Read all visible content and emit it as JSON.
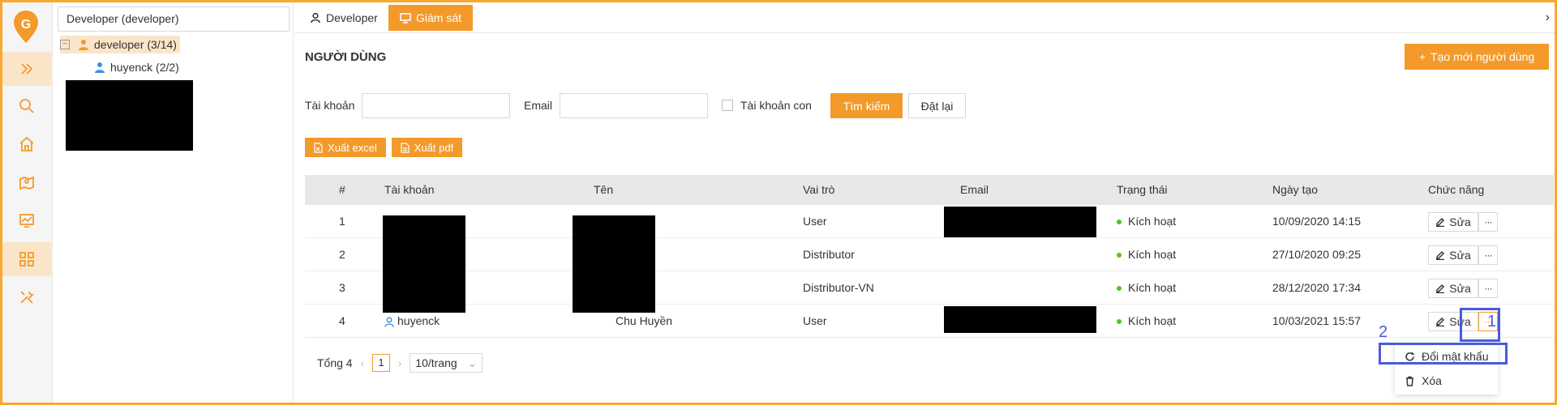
{
  "tree": {
    "search_value": "Developer (developer)",
    "root_node": "developer (3/14)",
    "child_node": "huyenck (2/2)"
  },
  "tabs": [
    {
      "label": "Developer"
    },
    {
      "label": "Giám sát"
    }
  ],
  "page_title": "NGƯỜI DÙNG",
  "create_button": "Tạo mới người dùng",
  "filters": {
    "account_label": "Tài khoản",
    "account_value": "",
    "email_label": "Email",
    "email_value": "",
    "sub_account_label": "Tài khoản con",
    "search_button": "Tìm kiếm",
    "reset_button": "Đặt lại"
  },
  "export": {
    "excel": "Xuất excel",
    "pdf": "Xuất pdf"
  },
  "table": {
    "headers": [
      "#",
      "Tài khoản",
      "Tên",
      "Vai trò",
      "Email",
      "Trạng thái",
      "Ngày tạo",
      "Chức năng"
    ],
    "rows": [
      {
        "index": "1",
        "account": "",
        "name": "",
        "role": "User",
        "email": "",
        "status": "Kích hoạt",
        "created": "10/09/2020 14:15"
      },
      {
        "index": "2",
        "account": "",
        "name": "",
        "role": "Distributor",
        "email": "",
        "status": "Kích hoạt",
        "created": "27/10/2020 09:25"
      },
      {
        "index": "3",
        "account": "",
        "name": "",
        "role": "Distributor-VN",
        "email": "",
        "status": "Kích hoạt",
        "created": "28/12/2020 17:34"
      },
      {
        "index": "4",
        "account": "huyenck",
        "name": "Chu Huyền",
        "role": "User",
        "email": "",
        "status": "Kích hoạt",
        "created": "10/03/2021 15:57"
      }
    ],
    "edit_label": "Sửa",
    "more_label": "···"
  },
  "pagination": {
    "total": "Tổng 4",
    "current_page": "1",
    "page_size": "10/trang"
  },
  "dropdown": {
    "change_password": "Đổi mật khẩu",
    "delete": "Xóa"
  },
  "annotations": {
    "step1": "1",
    "step2": "2"
  },
  "colors": {
    "accent": "#f39a2b",
    "highlight": "#4a5bdc",
    "status_active": "#52c41a"
  }
}
